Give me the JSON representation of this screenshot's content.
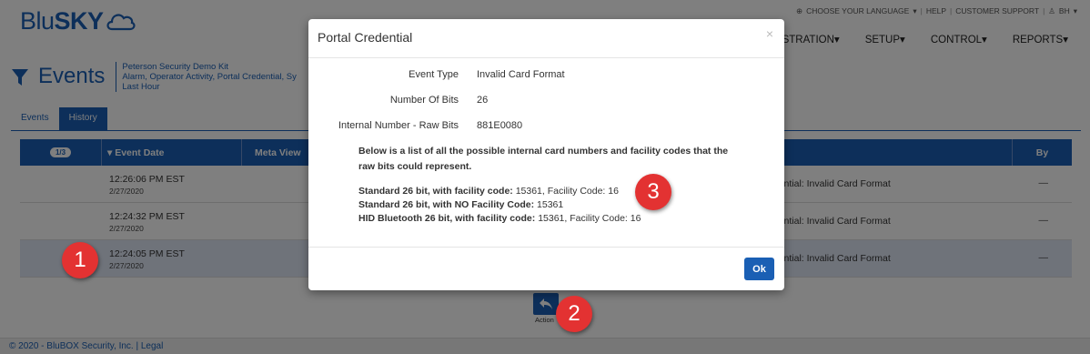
{
  "header": {
    "logo_text_a": "Blu",
    "logo_text_b": "SKY",
    "util_links": [
      "Choose your language",
      "Help",
      "Customer Support",
      "BH"
    ],
    "nav": [
      "STRATION",
      "SETUP",
      "CONTROL",
      "REPORTS"
    ]
  },
  "events": {
    "title": "Events",
    "sub_line1": "Peterson Security Demo Kit",
    "sub_line2": "Alarm, Operator Activity, Portal Credential, Sy",
    "sub_line3": "Last Hour"
  },
  "tabs": [
    {
      "label": "Events",
      "active": false
    },
    {
      "label": "History",
      "active": true
    }
  ],
  "grid": {
    "page_indicator": "1/3",
    "col_event_date": "Event Date",
    "col_meta_view": "Meta View",
    "col_by": "By",
    "rows": [
      {
        "time": "12:26:06 PM EST",
        "date": "2/27/2020",
        "desc": "edential: Invalid Card Format",
        "by": "—",
        "selected": false
      },
      {
        "time": "12:24:32 PM EST",
        "date": "2/27/2020",
        "desc": "edential: Invalid Card Format",
        "by": "—",
        "selected": false
      },
      {
        "time": "12:24:05 PM EST",
        "date": "2/27/2020",
        "desc": "edential: Invalid Card Format",
        "by": "—",
        "selected": true
      }
    ]
  },
  "action": {
    "label": "Action"
  },
  "footer": {
    "text": "© 2020 - BluBOX Security, Inc. | Legal"
  },
  "modal": {
    "title": "Portal Credential",
    "close": "×",
    "event_type_label": "Event Type",
    "event_type_value": "Invalid Card Format",
    "bits_label": "Number Of Bits",
    "bits_value": "26",
    "raw_label": "Internal Number - Raw Bits",
    "raw_value": "881E0080",
    "note": "Below is a list of all the possible internal card numbers and facility codes that the raw bits could represent.",
    "possibilities": [
      {
        "label": "Standard 26 bit, with facility code:",
        "value": "15361, Facility Code: 16"
      },
      {
        "label": "Standard 26 bit, with NO Facility Code:",
        "value": "15361"
      },
      {
        "label": "HID Bluetooth 26 bit, with facility code:",
        "value": "15361, Facility Code: 16"
      }
    ],
    "ok_label": "Ok"
  },
  "callouts": [
    "1",
    "2",
    "3"
  ],
  "colors": {
    "primary": "#1a5fb4",
    "callout": "#e33232"
  }
}
